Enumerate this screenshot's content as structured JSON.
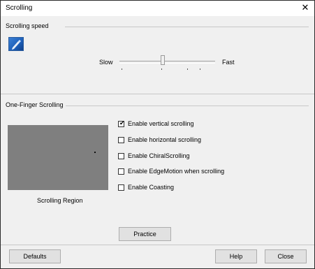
{
  "window": {
    "title": "Scrolling",
    "close_glyph": "✕"
  },
  "speed": {
    "group_label": "Scrolling speed",
    "icon": "scroll-pen-icon",
    "slow_label": "Slow",
    "fast_label": "Fast",
    "value_fraction": 0.45
  },
  "one_finger": {
    "group_label": "One-Finger Scrolling",
    "region_label": "Scrolling Region",
    "options": [
      {
        "label": "Enable vertical scrolling",
        "checked": true
      },
      {
        "label": "Enable horizontal scrolling",
        "checked": false
      },
      {
        "label": "Enable ChiralScrolling",
        "checked": false
      },
      {
        "label": "Enable EdgeMotion when scrolling",
        "checked": false
      },
      {
        "label": "Enable Coasting",
        "checked": false
      }
    ],
    "practice_label": "Practice"
  },
  "footer": {
    "defaults_label": "Defaults",
    "help_label": "Help",
    "close_label": "Close"
  },
  "colors": {
    "region_fill": "#7f7f7f",
    "icon_blue": "#1d5fb8"
  }
}
